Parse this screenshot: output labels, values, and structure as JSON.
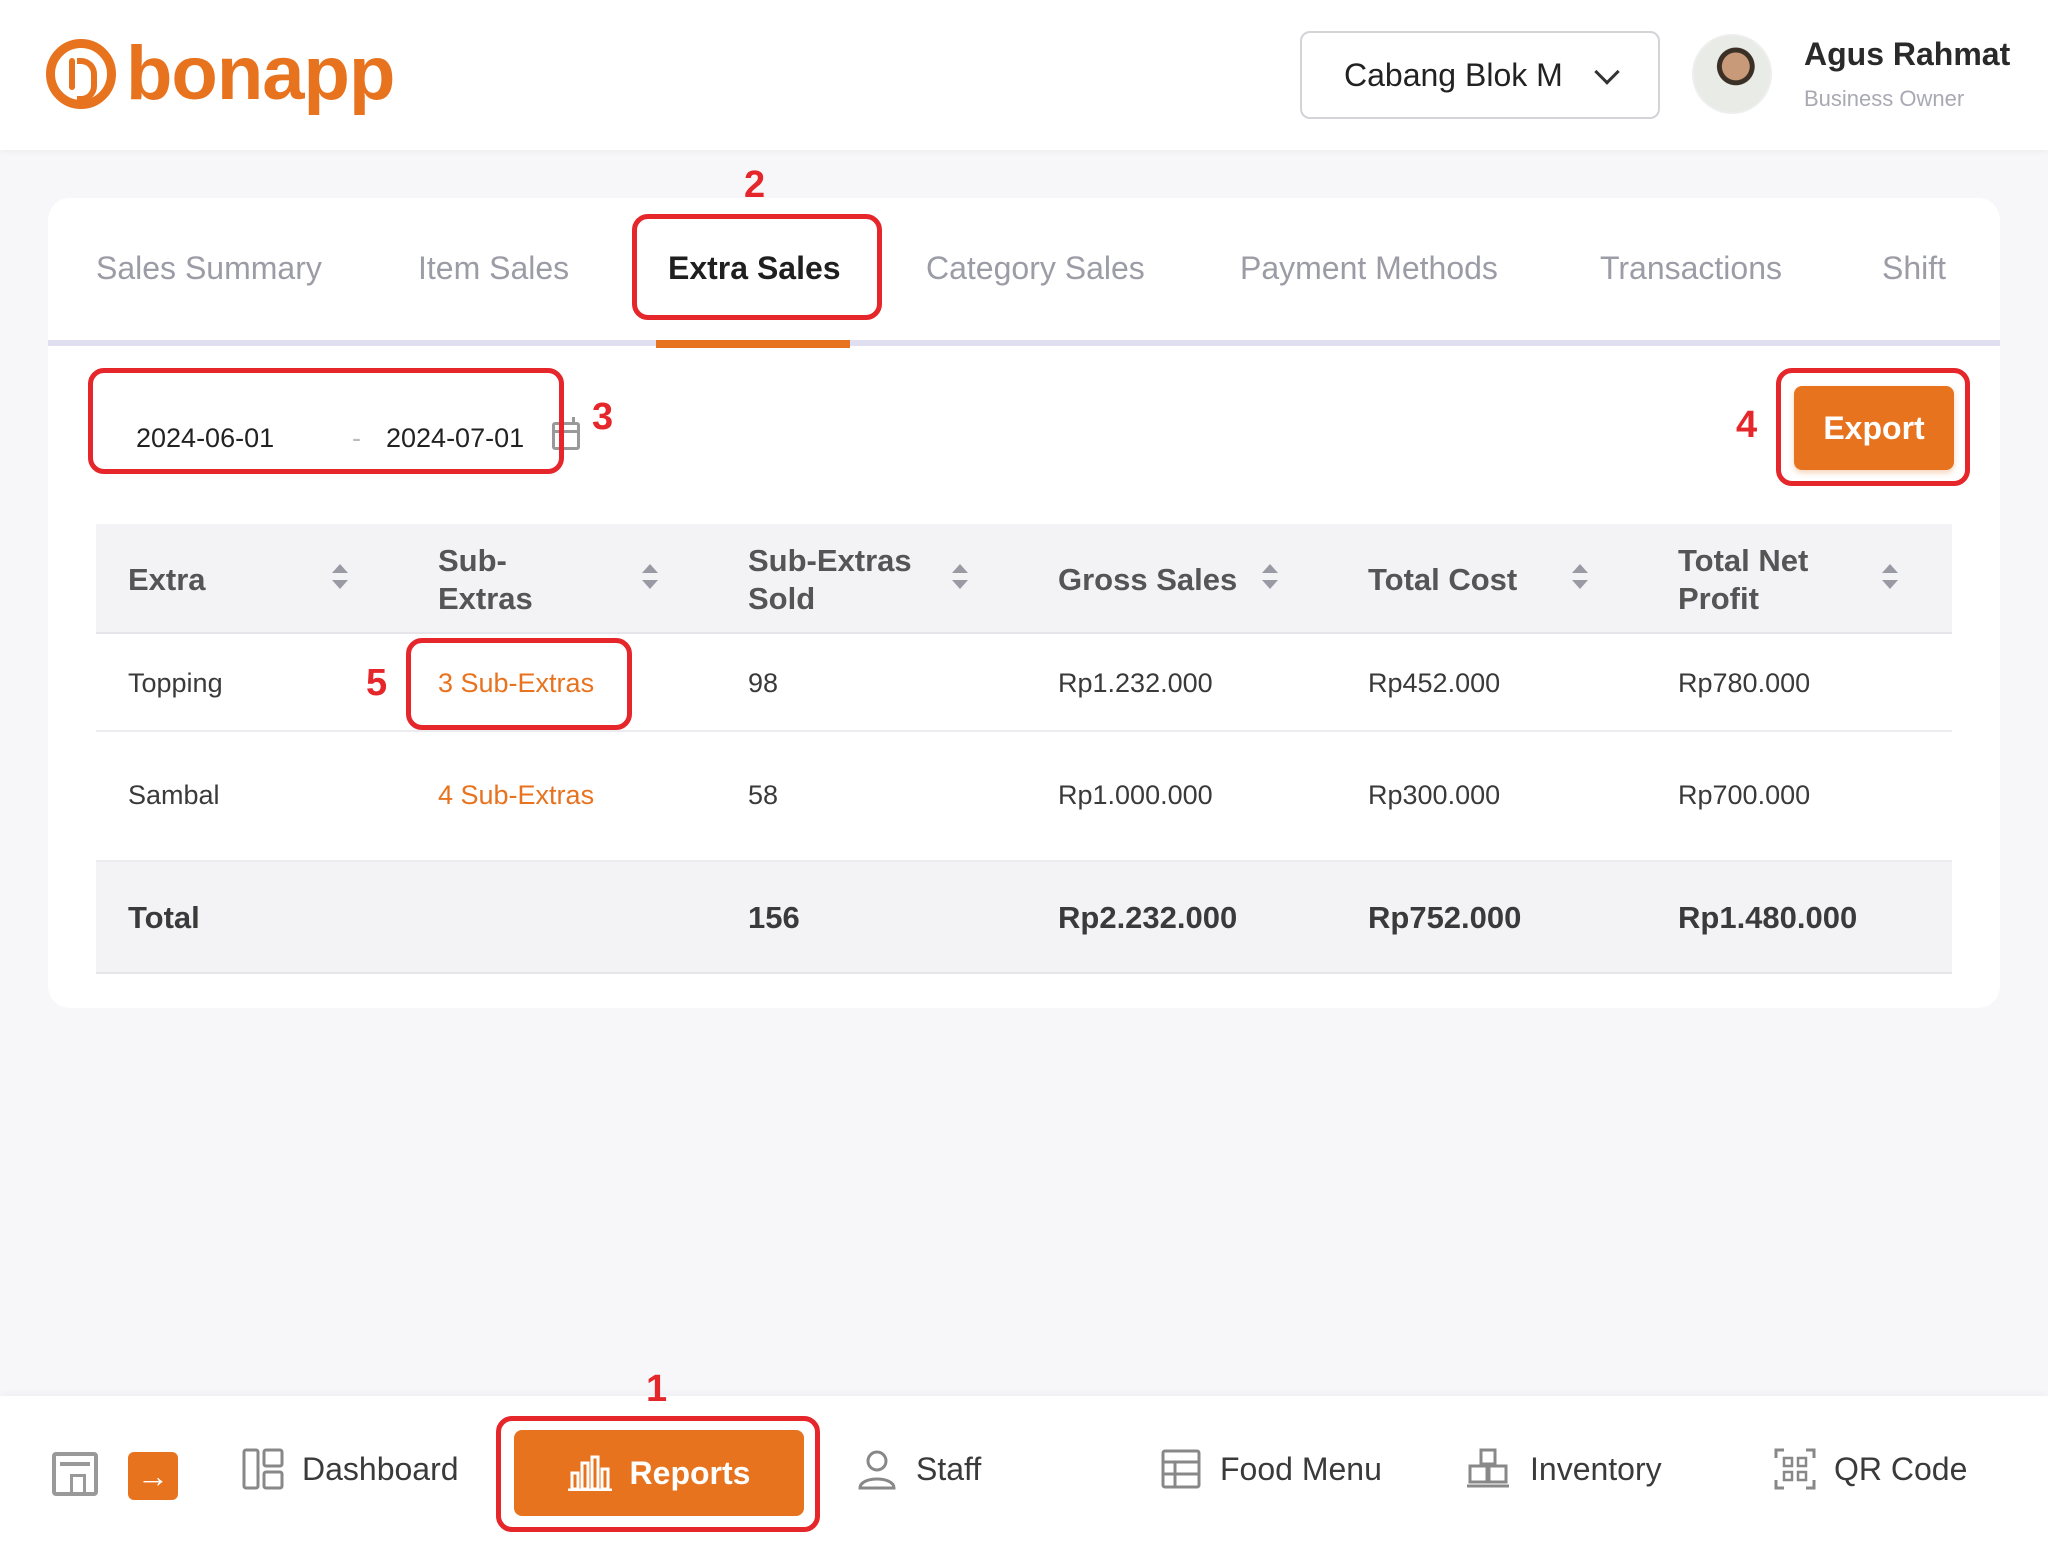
{
  "header": {
    "logo_text": "bonapp",
    "branch": "Cabang Blok M",
    "user_name": "Agus Rahmat",
    "user_role": "Business Owner"
  },
  "tabs": [
    {
      "label": "Sales Summary"
    },
    {
      "label": "Item Sales"
    },
    {
      "label": "Extra Sales",
      "active": true
    },
    {
      "label": "Category Sales"
    },
    {
      "label": "Payment Methods"
    },
    {
      "label": "Transactions"
    },
    {
      "label": "Shift"
    }
  ],
  "filters": {
    "date_start": "2024-06-01",
    "date_separator": "-",
    "date_end": "2024-07-01",
    "export_label": "Export"
  },
  "table": {
    "columns": [
      "Extra",
      "Sub-\nExtras",
      "Sub-Extras\nSold",
      "Gross Sales",
      "Total Cost",
      "Total Net\nProfit"
    ],
    "rows": [
      [
        "Topping",
        "3 Sub-Extras",
        "98",
        "Rp1.232.000",
        "Rp452.000",
        "Rp780.000"
      ],
      [
        "Sambal",
        "4 Sub-Extras",
        "58",
        "Rp1.000.000",
        "Rp300.000",
        "Rp700.000"
      ]
    ],
    "total": [
      "Total",
      "",
      "156",
      "Rp2.232.000",
      "Rp752.000",
      "Rp1.480.000"
    ]
  },
  "bottom_nav": {
    "dashboard": "Dashboard",
    "reports": "Reports",
    "staff": "Staff",
    "food_menu": "Food Menu",
    "inventory": "Inventory",
    "qr_code": "QR Code"
  },
  "annotations": [
    "1",
    "2",
    "3",
    "4",
    "5"
  ],
  "colors": {
    "accent": "#e8731f",
    "annotation": "#e5262a"
  }
}
